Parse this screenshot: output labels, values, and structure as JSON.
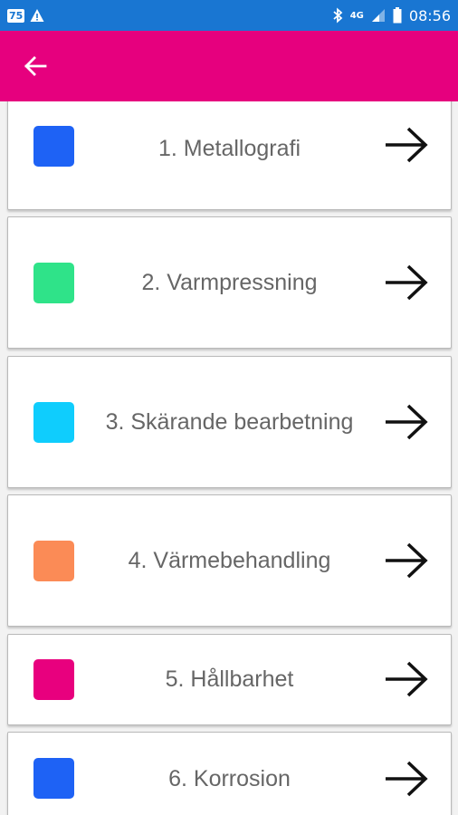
{
  "status_bar": {
    "badge": "75",
    "network": "4G",
    "time": "08:56",
    "icons": [
      "warning-icon",
      "bluetooth-icon",
      "signal-icon",
      "battery-icon"
    ]
  },
  "app_bar": {
    "color": "#e6007e",
    "back_icon": "back-arrow-icon"
  },
  "list": {
    "items": [
      {
        "label": "1. Metallografi",
        "color": "#1e62f5",
        "icon": "arrow-right-icon"
      },
      {
        "label": "2. Varmpressning",
        "color": "#2fe389",
        "icon": "arrow-right-icon"
      },
      {
        "label": "3. Skärande bearbetning",
        "color": "#0fcdfd",
        "icon": "arrow-right-icon"
      },
      {
        "label": "4. Värmebehandling",
        "color": "#fb8b56",
        "icon": "arrow-right-icon"
      },
      {
        "label": "5. Hållbarhet",
        "color": "#e8007e",
        "icon": "arrow-right-icon"
      },
      {
        "label": "6. Korrosion",
        "color": "#1e62f5",
        "icon": "arrow-right-icon"
      }
    ]
  }
}
